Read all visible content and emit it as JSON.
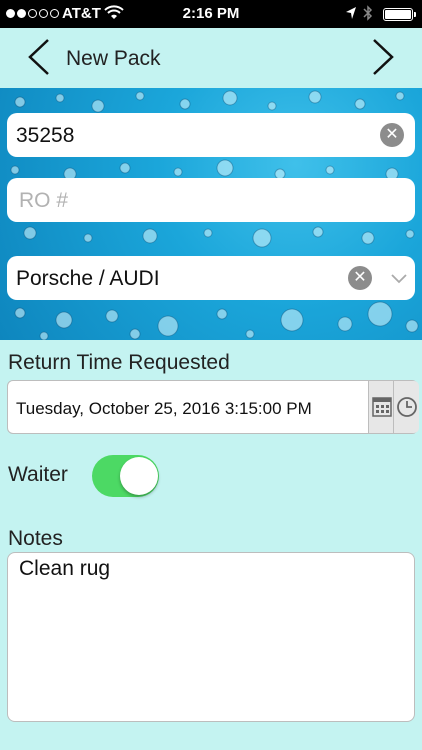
{
  "status_bar": {
    "carrier": "AT&T",
    "time": "2:16 PM",
    "signal_bars_filled": 2,
    "signal_bars_total": 5,
    "battery_percent": 100
  },
  "nav": {
    "title": "New Pack",
    "back_icon": "chevron-left-icon",
    "forward_icon": "chevron-right-icon"
  },
  "form": {
    "stock_number": "35258",
    "ro_placeholder": "RO #",
    "make": "Porsche / AUDI",
    "return_time_label": "Return Time Requested",
    "return_time_value": "Tuesday, October 25, 2016 3:15:00 PM",
    "waiter_label": "Waiter",
    "waiter_on": true,
    "notes_label": "Notes",
    "notes_value": "Clean rug"
  },
  "colors": {
    "background": "#c4f3f1",
    "toggle_on": "#4cd964",
    "banner": "#1ba6da"
  }
}
